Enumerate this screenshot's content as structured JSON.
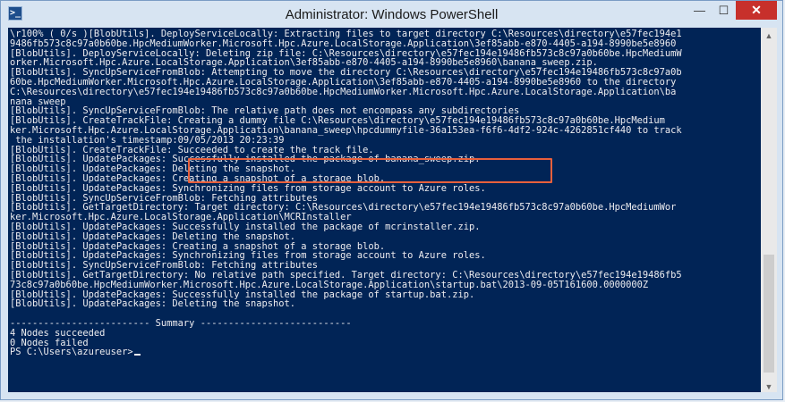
{
  "window": {
    "title": "Administrator: Windows PowerShell",
    "app_icon_glyph": ">_",
    "minimize_glyph": "—",
    "maximize_glyph": "☐",
    "close_glyph": "✕"
  },
  "console": {
    "background": "#012456",
    "foreground": "#eeedf0",
    "highlight_color": "#e8603c",
    "lines": [
      "\\r100% ( 0/s )[BlobUtils]. DeployServiceLocally: Extracting files to target directory C:\\Resources\\directory\\e57fec194e1",
      "9486fb573c8c97a0b60be.HpcMediumWorker.Microsoft.Hpc.Azure.LocalStorage.Application\\3ef85abb-e870-4405-a194-8990be5e8960",
      "[BlobUtils]. DeployServiceLocally: Deleting zip file: C:\\Resources\\directory\\e57fec194e19486fb573c8c97a0b60be.HpcMediumW",
      "orker.Microsoft.Hpc.Azure.LocalStorage.Application\\3ef85abb-e870-4405-a194-8990be5e8960\\banana_sweep.zip.",
      "[BlobUtils]. SyncUpServiceFromBlob: Attempting to move the directory C:\\Resources\\directory\\e57fec194e19486fb573c8c97a0b",
      "60be.HpcMediumWorker.Microsoft.Hpc.Azure.LocalStorage.Application\\3ef85abb-e870-4405-a194-8990be5e8960 to the directory",
      "C:\\Resources\\directory\\e57fec194e19486fb573c8c97a0b60be.HpcMediumWorker.Microsoft.Hpc.Azure.LocalStorage.Application\\ba",
      "nana_sweep",
      "[BlobUtils]. SyncUpServiceFromBlob: The relative path does not encompass any subdirectories",
      "[BlobUtils]. CreateTrackFile: Creating a dummy file C:\\Resources\\directory\\e57fec194e19486fb573c8c97a0b60be.HpcMedium",
      "ker.Microsoft.Hpc.Azure.LocalStorage.Application\\banana_sweep\\hpcdummyfile-36a153ea-f6f6-4df2-924c-4262851cf440 to track",
      " the installation's timestamp:09/05/2013 20:23:39",
      "[BlobUtils]. CreateTrackFile: Succeeded to create the track file.",
      "[BlobUtils]. UpdatePackages: Successfully installed the package of banana_sweep.zip.",
      "[BlobUtils]. UpdatePackages: Deleting the snapshot.",
      "[BlobUtils]. UpdatePackages: Creating a snapshot of a storage blob.",
      "[BlobUtils]. UpdatePackages: Synchronizing files from storage account to Azure roles.",
      "[BlobUtils]. SyncUpServiceFromBlob: Fetching attributes",
      "[BlobUtils]. GetTargetDirectory: Target directory: C:\\Resources\\directory\\e57fec194e19486fb573c8c97a0b60be.HpcMediumWor",
      "ker.Microsoft.Hpc.Azure.LocalStorage.Application\\MCRInstaller",
      "[BlobUtils]. UpdatePackages: Successfully installed the package of mcrinstaller.zip.",
      "[BlobUtils]. UpdatePackages: Deleting the snapshot.",
      "[BlobUtils]. UpdatePackages: Creating a snapshot of a storage blob.",
      "[BlobUtils]. UpdatePackages: Synchronizing files from storage account to Azure roles.",
      "[BlobUtils]. SyncUpServiceFromBlob: Fetching attributes",
      "[BlobUtils]. GetTargetDirectory: No relative path specified. Target directory: C:\\Resources\\directory\\e57fec194e19486fb5",
      "73c8c97a0b60be.HpcMediumWorker.Microsoft.Hpc.Azure.LocalStorage.Application\\startup.bat\\2013-09-05T161600.0000000Z",
      "[BlobUtils]. UpdatePackages: Successfully installed the package of startup.bat.zip.",
      "[BlobUtils]. UpdatePackages: Deleting the snapshot.",
      "",
      "------------------------- Summary ---------------------------",
      "4 Nodes succeeded",
      "0 Nodes failed"
    ],
    "prompt": "PS C:\\Users\\azureuser>"
  },
  "scrollbar": {
    "up_glyph": "▲",
    "down_glyph": "▼",
    "position": 0.97,
    "visible_fraction": 0.35
  }
}
